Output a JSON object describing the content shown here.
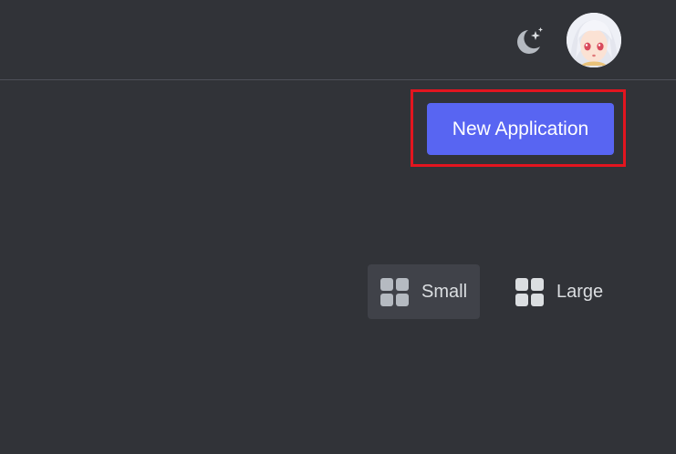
{
  "header": {
    "theme_toggle_icon": "moon-stars-icon",
    "avatar_icon": "user-avatar-anime-girl"
  },
  "toolbar": {
    "new_application_label": "New Application",
    "highlight_color": "#e3151f",
    "button_color": "#5865f2"
  },
  "view_toggle": {
    "selected": "Small",
    "options": [
      {
        "label": "Small",
        "icon": "grid-small-icon"
      },
      {
        "label": "Large",
        "icon": "grid-large-icon"
      }
    ]
  }
}
